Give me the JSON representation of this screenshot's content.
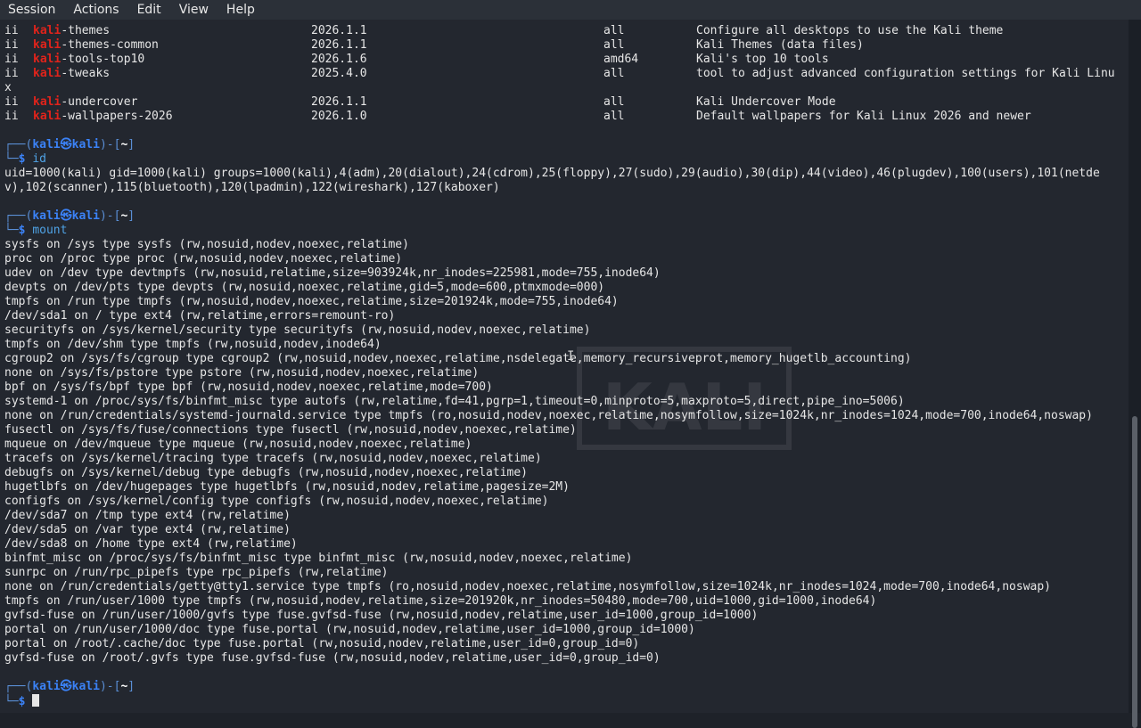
{
  "menu": [
    "Session",
    "Actions",
    "Edit",
    "View",
    "Help"
  ],
  "packages": [
    {
      "status": "ii",
      "prefix": "kali",
      "suffix": "-themes",
      "version": "2026.1.1",
      "arch": "all",
      "desc": "Configure all desktops to use the Kali theme"
    },
    {
      "status": "ii",
      "prefix": "kali",
      "suffix": "-themes-common",
      "version": "2026.1.1",
      "arch": "all",
      "desc": "Kali Themes (data files)"
    },
    {
      "status": "ii",
      "prefix": "kali",
      "suffix": "-tools-top10",
      "version": "2026.1.6",
      "arch": "amd64",
      "desc": "Kali's top 10 tools"
    },
    {
      "status": "ii",
      "prefix": "kali",
      "suffix": "-tweaks",
      "version": "2025.4.0",
      "arch": "all",
      "desc": "tool to adjust advanced configuration settings for Kali Linu"
    }
  ],
  "wrap_x": "x",
  "packages2": [
    {
      "status": "ii",
      "prefix": "kali",
      "suffix": "-undercover",
      "version": "2026.1.1",
      "arch": "all",
      "desc": "Kali Undercover Mode"
    },
    {
      "status": "ii",
      "prefix": "kali",
      "suffix": "-wallpapers-2026",
      "version": "2026.1.0",
      "arch": "all",
      "desc": "Default wallpapers for Kali Linux 2026 and newer"
    }
  ],
  "prompt": {
    "open": "┌──(",
    "user": "kali",
    "at": "㉿",
    "host": "kali",
    "close": ")-[",
    "dir": "~",
    "end": "]",
    "line2": "└─",
    "dollar": "$"
  },
  "cmd_id": "id",
  "id_output": [
    "uid=1000(kali) gid=1000(kali) groups=1000(kali),4(adm),20(dialout),24(cdrom),25(floppy),27(sudo),29(audio),30(dip),44(video),46(plugdev),100(users),101(netde",
    "v),102(scanner),115(bluetooth),120(lpadmin),122(wireshark),127(kaboxer)"
  ],
  "cmd_mount": "mount",
  "mount_output": [
    "sysfs on /sys type sysfs (rw,nosuid,nodev,noexec,relatime)",
    "proc on /proc type proc (rw,nosuid,nodev,noexec,relatime)",
    "udev on /dev type devtmpfs (rw,nosuid,relatime,size=903924k,nr_inodes=225981,mode=755,inode64)",
    "devpts on /dev/pts type devpts (rw,nosuid,noexec,relatime,gid=5,mode=600,ptmxmode=000)",
    "tmpfs on /run type tmpfs (rw,nosuid,nodev,noexec,relatime,size=201924k,mode=755,inode64)",
    "/dev/sda1 on / type ext4 (rw,relatime,errors=remount-ro)",
    "securityfs on /sys/kernel/security type securityfs (rw,nosuid,nodev,noexec,relatime)",
    "tmpfs on /dev/shm type tmpfs (rw,nosuid,nodev,inode64)",
    "cgroup2 on /sys/fs/cgroup type cgroup2 (rw,nosuid,nodev,noexec,relatime,nsdelegate,memory_recursiveprot,memory_hugetlb_accounting)",
    "none on /sys/fs/pstore type pstore (rw,nosuid,nodev,noexec,relatime)",
    "bpf on /sys/fs/bpf type bpf (rw,nosuid,nodev,noexec,relatime,mode=700)",
    "systemd-1 on /proc/sys/fs/binfmt_misc type autofs (rw,relatime,fd=41,pgrp=1,timeout=0,minproto=5,maxproto=5,direct,pipe_ino=5006)",
    "none on /run/credentials/systemd-journald.service type tmpfs (ro,nosuid,nodev,noexec,relatime,nosymfollow,size=1024k,nr_inodes=1024,mode=700,inode64,noswap)",
    "fusectl on /sys/fs/fuse/connections type fusectl (rw,nosuid,nodev,noexec,relatime)",
    "mqueue on /dev/mqueue type mqueue (rw,nosuid,nodev,noexec,relatime)",
    "tracefs on /sys/kernel/tracing type tracefs (rw,nosuid,nodev,noexec,relatime)",
    "debugfs on /sys/kernel/debug type debugfs (rw,nosuid,nodev,noexec,relatime)",
    "hugetlbfs on /dev/hugepages type hugetlbfs (rw,nosuid,nodev,relatime,pagesize=2M)",
    "configfs on /sys/kernel/config type configfs (rw,nosuid,nodev,noexec,relatime)",
    "/dev/sda7 on /tmp type ext4 (rw,relatime)",
    "/dev/sda5 on /var type ext4 (rw,relatime)",
    "/dev/sda8 on /home type ext4 (rw,relatime)",
    "binfmt_misc on /proc/sys/fs/binfmt_misc type binfmt_misc (rw,nosuid,nodev,noexec,relatime)",
    "sunrpc on /run/rpc_pipefs type rpc_pipefs (rw,relatime)",
    "none on /run/credentials/getty@tty1.service type tmpfs (ro,nosuid,nodev,noexec,relatime,nosymfollow,size=1024k,nr_inodes=1024,mode=700,inode64,noswap)",
    "tmpfs on /run/user/1000 type tmpfs (rw,nosuid,nodev,relatime,size=201920k,nr_inodes=50480,mode=700,uid=1000,gid=1000,inode64)",
    "gvfsd-fuse on /run/user/1000/gvfs type fuse.gvfsd-fuse (rw,nosuid,nodev,relatime,user_id=1000,group_id=1000)",
    "portal on /run/user/1000/doc type fuse.portal (rw,nosuid,nodev,relatime,user_id=1000,group_id=1000)",
    "portal on /root/.cache/doc type fuse.portal (rw,nosuid,nodev,relatime,user_id=0,group_id=0)",
    "gvfsd-fuse on /root/.gvfs type fuse.gvfsd-fuse (rw,nosuid,nodev,relatime,user_id=0,group_id=0)"
  ],
  "watermark_text": "KALI"
}
